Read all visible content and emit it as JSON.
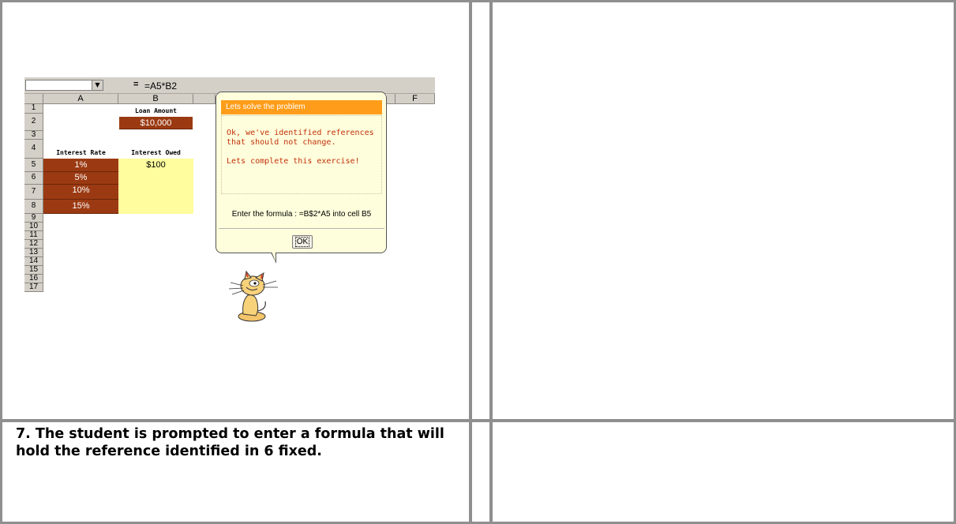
{
  "spreadsheet": {
    "formula_bar": {
      "name_box_arrow": "▼",
      "equals": "=",
      "formula": "=A5*B2"
    },
    "columns": [
      "A",
      "B",
      "F"
    ],
    "rows": [
      "1",
      "2",
      "3",
      "4",
      "5",
      "6",
      "7",
      "8",
      "9",
      "10",
      "11",
      "12",
      "13",
      "14",
      "15",
      "16",
      "17"
    ],
    "labels": {
      "loan_amount": "Loan Amount",
      "interest_rate": "Interest Rate",
      "interest_owed": "Interest Owed"
    },
    "loan_amount_value": "$10,000",
    "rates": [
      "1%",
      "5%",
      "10%",
      "15%"
    ],
    "owed": [
      "$100",
      "",
      "",
      ""
    ]
  },
  "bubble": {
    "title": "Lets solve the problem",
    "message_line1": "Ok, we've identified references that should not change.",
    "message_line2": "Lets complete this exercise!",
    "instruction": "Enter the formula : =B$2*A5 into cell B5",
    "ok_label": "OK"
  },
  "colors": {
    "rate_fill": "#9b3a12",
    "owed_fill": "#fffd9d",
    "bubble_header": "#ff9d1a",
    "message_text": "#c2300a"
  },
  "caption": "7. The student is prompted to enter a formula that will hold the reference identified in 6 fixed."
}
